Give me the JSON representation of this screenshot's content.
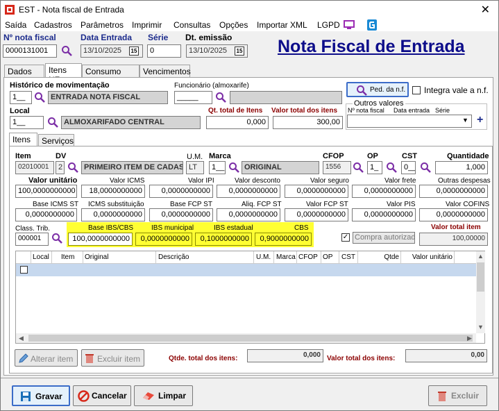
{
  "window": {
    "title": "EST - Nota fiscal de Entrada",
    "close": "✕"
  },
  "menu": [
    "Saída",
    "Cadastros",
    "Parâmetros",
    "Imprimir",
    "Consultas",
    "Opções",
    "Importar XML",
    "LGPD"
  ],
  "header": {
    "nota_fiscal_label": "Nº nota fiscal",
    "nota_fiscal_value": "0000131001",
    "data_entrada_label": "Data Entrada",
    "data_entrada_value": "13/10/2025",
    "serie_label": "Série",
    "serie_value": "0",
    "dt_emissao_label": "Dt. emissão",
    "dt_emissao_value": "13/10/2025",
    "calendar_glyph": "15",
    "big_title": "Nota Fiscal de Entrada"
  },
  "tabs": [
    "Dados NF",
    "Itens NF",
    "Consumo direto",
    "Vencimentos"
  ],
  "itens_nf": {
    "historico_label": "Histórico de movimentação",
    "historico_code": "1__",
    "historico_desc": "ENTRADA NOTA FISCAL",
    "funcionario_label": "Funcionário (almoxarife)",
    "funcionario_code": "_____",
    "funcionario_desc": "",
    "ped_button": "Ped. da n.f.",
    "integra_label": "Integra vale a n.f.",
    "local_label": "Local",
    "local_code": "1__",
    "local_desc": "ALMOXARIFADO CENTRAL",
    "qt_total_label": "Qt. total de Itens",
    "qt_total_value": "0,000",
    "valor_total_label": "Valor total dos itens",
    "valor_total_value": "300,00",
    "outros_valores_label": "Outros valores",
    "outros_cols": [
      "Nº nota fiscal",
      "Data entrada",
      "Série"
    ],
    "plus": "+"
  },
  "subtabs": [
    "Itens",
    "Serviços"
  ],
  "item": {
    "item_label": "Item",
    "item_value": "02010001",
    "dv_label": "DV",
    "dv_value": "2",
    "desc_value": "PRIMEIRO ITEM DE CADAS",
    "um_label": "U.M.",
    "um_value": "LT",
    "marca_label": "Marca",
    "marca_code": "1__",
    "marca_desc": "ORIGINAL",
    "cfop_label": "CFOP",
    "cfop_value": "1556",
    "op_label": "OP",
    "op_value": "1_",
    "cst_label": "CST",
    "cst_value": "0__",
    "quantidade_label": "Quantidade",
    "quantidade_value": "1,000"
  },
  "row2": {
    "labels": [
      "Valor unitário",
      "Valor ICMS",
      "Valor IPI",
      "Valor desconto",
      "Valor seguro",
      "Valor frete",
      "Outras despesas"
    ],
    "values": [
      "100,0000000000",
      "18,0000000000",
      "0,0000000000",
      "0,0000000000",
      "0,0000000000",
      "0,0000000000",
      "0,0000000000"
    ]
  },
  "row3": {
    "labels": [
      "Base ICMS ST",
      "ICMS substituição",
      "Base FCP ST",
      "Aliq. FCP ST",
      "Valor FCP ST",
      "Valor PIS",
      "Valor COFINS"
    ],
    "values": [
      "0,0000000000",
      "0,0000000000",
      "0,0000000000",
      "0,0000000000",
      "0,0000000000",
      "0,0000000000",
      "0,0000000000"
    ]
  },
  "row4": {
    "class_trib_label": "Class. Trib.",
    "class_trib_value": "000001",
    "ibs_labels": [
      "Base IBS/CBS",
      "IBS municipal",
      "IBS estadual",
      "CBS"
    ],
    "ibs_values": [
      "100,0000000000",
      "0,0000000000",
      "0,1000000000",
      "0,9000000000"
    ],
    "compra_label": "Compra autorizada",
    "valor_total_item_label": "Valor total item",
    "valor_total_item_value": "100,00000"
  },
  "grid": {
    "columns": [
      "Local",
      "Item",
      "Original",
      "Descrição",
      "U.M.",
      "Marca",
      "CFOP",
      "OP",
      "CST",
      "Qtde",
      "Valor unitário"
    ]
  },
  "footer": {
    "alterar": "Alterar item",
    "excluir_item": "Excluir item",
    "qtde_total_label": "Qtde. total dos itens:",
    "qtde_total_value": "0,000",
    "valor_total_label": "Valor total dos itens:",
    "valor_total_value": "0,00"
  },
  "bottom": {
    "gravar": "Gravar",
    "cancelar": "Cancelar",
    "limpar": "Limpar",
    "excluir": "Excluir"
  }
}
